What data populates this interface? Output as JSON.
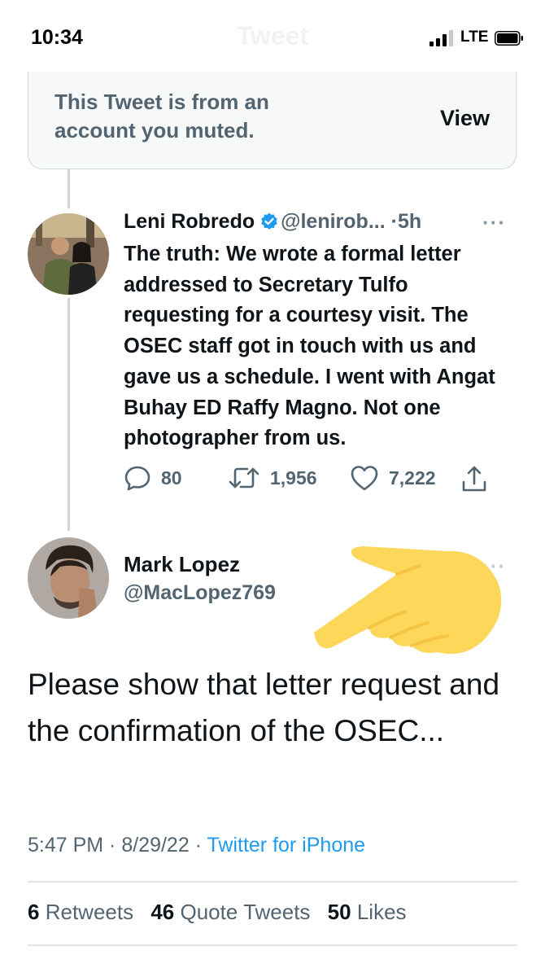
{
  "status_bar": {
    "time": "10:34",
    "network": "LTE",
    "ghost_title": "Tweet"
  },
  "muted_notice": {
    "text": "This Tweet is from an account you muted.",
    "view_label": "View"
  },
  "quoted_tweet": {
    "author_name": "Leni Robredo",
    "verified_icon": "verified-badge-icon",
    "handle": "@lenirob...",
    "separator": "·",
    "time": "5h",
    "more_icon": "···",
    "body": "The truth: We wrote a formal letter addressed to Secretary Tulfo requesting for a courtesy visit. The OSEC staff got in touch with us and gave us a schedule. I went with Angat Buhay ED Raffy Magno. Not one photographer from us.",
    "actions": {
      "replies": "80",
      "retweets": "1,956",
      "likes": "7,222"
    }
  },
  "main_tweet": {
    "author_name": "Mark Lopez",
    "handle": "@MacLopez769",
    "more_icon": "···",
    "body": "Please show that letter request and the confirmation of the OSEC...",
    "timestamp": "5:47 PM · 8/29/22 · ",
    "source": "Twitter for iPhone",
    "stats": {
      "retweets_count": "6",
      "retweets_label": "Retweets",
      "quotes_count": "46",
      "quotes_label": "Quote Tweets",
      "likes_count": "50",
      "likes_label": "Likes"
    }
  },
  "colors": {
    "link_blue": "#1d9bf0",
    "secondary_text": "#536471",
    "pointer_emoji_yellow": "#fdd75a"
  },
  "annotation_icon": "pointing-hand-emoji"
}
